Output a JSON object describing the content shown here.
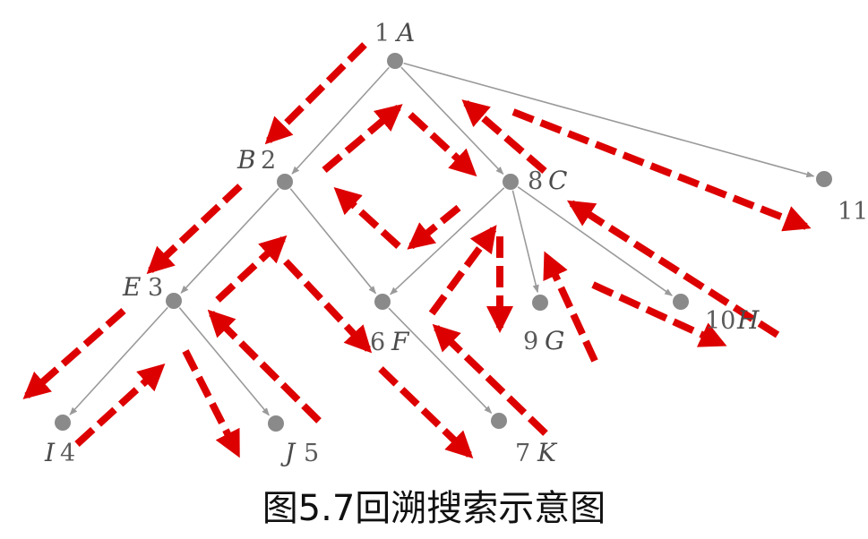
{
  "caption": "图5.7回溯搜索示意图",
  "colors": {
    "tree_edge": "#9a9a9a",
    "node": "#8a8a8a",
    "search_arrow": "#dd0000"
  },
  "nodes": [
    {
      "id": "A",
      "number": "1",
      "letter": "A"
    },
    {
      "id": "B",
      "number": "2",
      "letter": "B"
    },
    {
      "id": "E",
      "number": "3",
      "letter": "E"
    },
    {
      "id": "I",
      "number": "4",
      "letter": "I"
    },
    {
      "id": "J",
      "number": "5",
      "letter": "J"
    },
    {
      "id": "F",
      "number": "6",
      "letter": "F"
    },
    {
      "id": "K",
      "number": "7",
      "letter": "K"
    },
    {
      "id": "C",
      "number": "8",
      "letter": "C"
    },
    {
      "id": "G",
      "number": "9",
      "letter": "G"
    },
    {
      "id": "H",
      "number": "10",
      "letter": "H"
    },
    {
      "id": "N11",
      "number": "11",
      "letter": ""
    }
  ],
  "edges": [
    [
      "A",
      "B"
    ],
    [
      "A",
      "C"
    ],
    [
      "A",
      "N11"
    ],
    [
      "B",
      "E"
    ],
    [
      "B",
      "F"
    ],
    [
      "E",
      "I"
    ],
    [
      "E",
      "J"
    ],
    [
      "C",
      "F"
    ],
    [
      "C",
      "G"
    ],
    [
      "C",
      "H"
    ],
    [
      "F",
      "K"
    ]
  ],
  "search_order": [
    "A",
    "B",
    "E",
    "I",
    "J",
    "F",
    "K",
    "C",
    "G",
    "H",
    "N11"
  ]
}
